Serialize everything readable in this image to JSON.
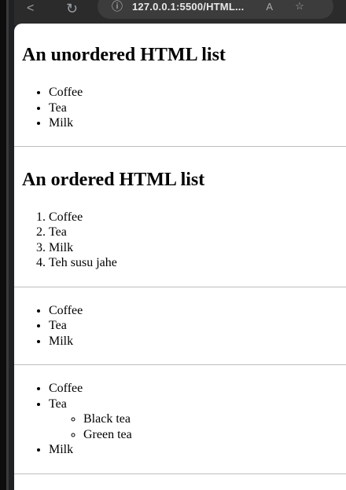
{
  "browser": {
    "url": "127.0.0.1:5500/HTML...",
    "back_icon": "back-arrow-icon",
    "reload_icon": "reload-icon"
  },
  "page": {
    "heading_unordered": "An unordered HTML list",
    "list1": [
      "Coffee",
      "Tea",
      "Milk"
    ],
    "heading_ordered": "An ordered HTML list",
    "list2": [
      "Coffee",
      "Tea",
      "Milk",
      "Teh susu jahe"
    ],
    "list3": [
      "Coffee",
      "Tea",
      "Milk"
    ],
    "list4": {
      "items": [
        "Coffee",
        "Tea",
        "Milk"
      ],
      "nested_under_tea": [
        "Black tea",
        "Green tea"
      ]
    }
  }
}
